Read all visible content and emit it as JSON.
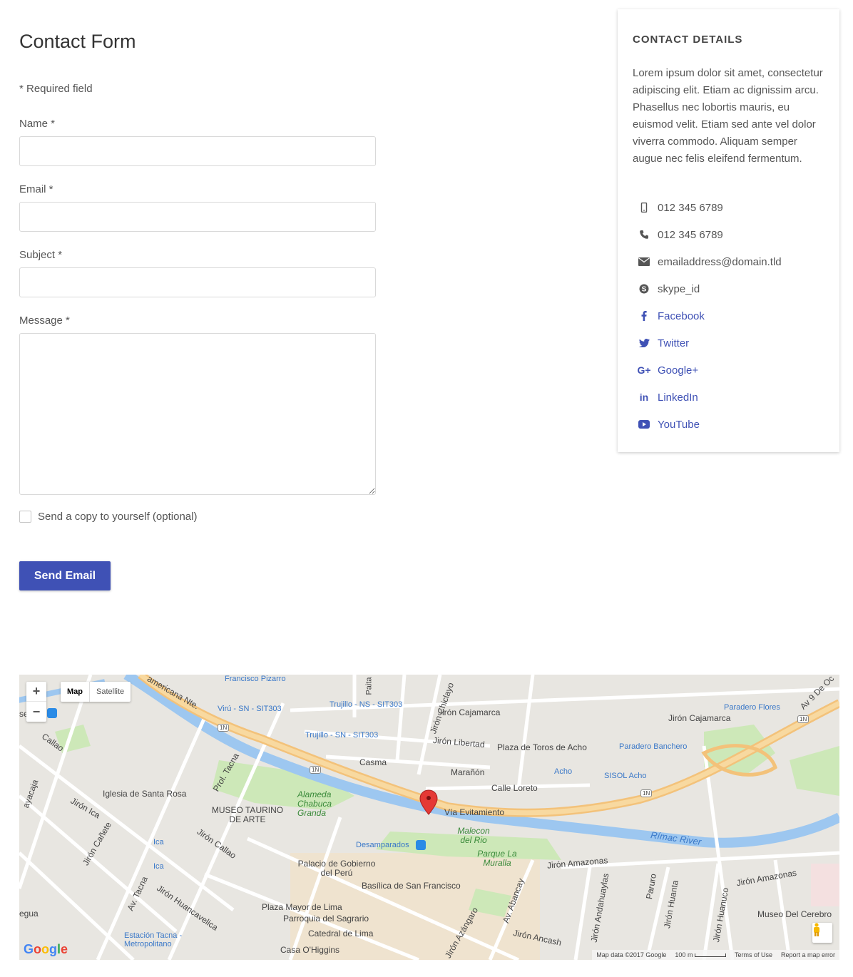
{
  "form": {
    "title": "Contact Form",
    "required_note": "* Required field",
    "name_label": "Name *",
    "email_label": "Email *",
    "subject_label": "Subject *",
    "message_label": "Message *",
    "name_value": "",
    "email_value": "",
    "subject_value": "",
    "message_value": "",
    "copy_label": "Send a copy to yourself (optional)",
    "copy_checked": false,
    "submit_label": "Send Email"
  },
  "details": {
    "title": "CONTACT DETAILS",
    "text": "Lorem ipsum dolor sit amet, consectetur adipiscing elit. Etiam ac dignissim arcu. Phasellus nec lobortis mauris, eu euismod velit. Etiam sed ante vel dolor viverra commodo. Aliquam semper augue nec felis eleifend fermentum.",
    "items": [
      {
        "icon": "mobile-icon",
        "label": "012 345 6789"
      },
      {
        "icon": "phone-icon",
        "label": "012 345 6789"
      },
      {
        "icon": "envelope-icon",
        "label": "emailaddress@domain.tld"
      },
      {
        "icon": "skype-icon",
        "label": "skype_id"
      },
      {
        "icon": "facebook-icon",
        "label": "Facebook"
      },
      {
        "icon": "twitter-icon",
        "label": "Twitter"
      },
      {
        "icon": "google-plus-icon",
        "label": "Google+"
      },
      {
        "icon": "linkedin-icon",
        "label": "LinkedIn"
      },
      {
        "icon": "youtube-icon",
        "label": "YouTube"
      }
    ],
    "accent_color": "#3f51b5"
  },
  "map": {
    "zoom_in": "+",
    "zoom_out": "−",
    "type_map": "Map",
    "type_satellite": "Satellite",
    "labels": {
      "francisco_pizarro": "Francisco Pizarro",
      "americana": "americana Nte.",
      "viru": "Virú - SN - SIT303",
      "trujillo_ns": "Trujillo - NS - SIT303",
      "trujillo_sn": "Trujillo - SN - SIT303",
      "jiron_chiclayo": "Jirón Chiclayo",
      "jiron_cajamarca": "Jirón Cajamarca",
      "jiron_cajamarca2": "Jirón Cajamarca",
      "jiron_libertad": "Jirón Libertad",
      "plaza_toros": "Plaza de Toros de Acho",
      "paradero_flores": "Paradero Flores",
      "paradero_banchero": "Paradero Banchero",
      "av_9": "Av 9 De Oc",
      "callao": "Callao",
      "casma": "Casma",
      "maranon": "Marañón",
      "acho": "Acho",
      "sisol": "SISOL Acho",
      "calle_loreto": "Calle Loreto",
      "via_evitamiento": "Vía Evitamiento",
      "iglesia": "Iglesia de Santa Rosa",
      "prol_tacna": "Prol. Tacna",
      "alameda": "Alameda Chabuca Granda",
      "museo_taurino": "MUSEO TAURINO DE ARTE",
      "jiron_ica": "Jirón Ica",
      "jiron_canete": "Jirón Cañete",
      "jiron_callao": "Jirón Callao",
      "ica1": "Ica",
      "ica2": "Ica",
      "desamparados": "Desamparados",
      "malecon": "Malecon del Rio",
      "parque_muralla": "Parque La Muralla",
      "rimac": "Rímac River",
      "jiron_amazonas": "Jirón Amazonas",
      "jiron_amazonas2": "Jirón Amazonas",
      "palacio": "Palacio de Gobierno del Perú",
      "basilica": "Basílica de San Francisco",
      "plaza_mayor": "Plaza Mayor de Lima",
      "parroquia": "Parroquia del Sagrario",
      "catedral": "Catedral de Lima",
      "casa_ohiggins": "Casa O'Higgins",
      "estacion_tacna": "Estación Tacna - Metropolitano",
      "av_tacna": "Av. Tacna",
      "jiron_huancavelica": "Jirón Huancavelica",
      "jiron_azangaro": "Jirón Azángaro",
      "av_abancay": "Av. Abancay",
      "jiron_ancash": "Jirón Ancash",
      "jiron_andahuaylas": "Jirón Andahuaylas",
      "paruro": "Paruro",
      "jiron_huanta": "Jirón Huanta",
      "jiron_huanuco": "Jirón Huanuco",
      "museo_cerebro": "Museo Del Cerebro",
      "jiron_cayacaja": "ayacaja",
      "egua": "egua",
      "se": "se",
      "paita": "Paita",
      "hw_1n_a": "1N",
      "hw_1n_b": "1N",
      "hw_1n_c": "1N",
      "hw_1n_d": "1N"
    },
    "logo": "Google",
    "footer_data": "Map data ©2017 Google",
    "footer_scale": "100 m",
    "footer_terms": "Terms of Use",
    "footer_report": "Report a map error"
  }
}
